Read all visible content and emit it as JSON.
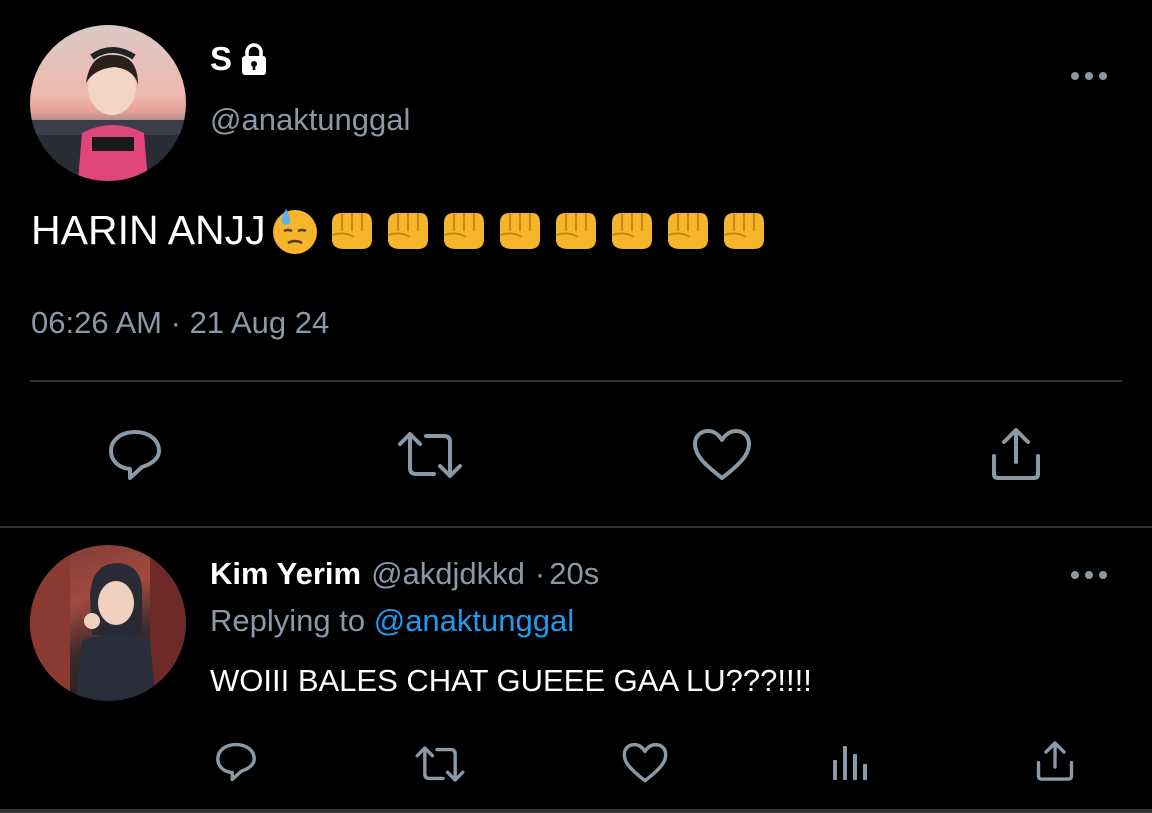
{
  "main_tweet": {
    "display_name": "S",
    "handle": "@anaktunggal",
    "text": "HARIN ANJJ",
    "emojis": [
      "downcast-face-with-sweat",
      "oncoming-fist",
      "oncoming-fist",
      "oncoming-fist",
      "oncoming-fist",
      "oncoming-fist",
      "oncoming-fist",
      "oncoming-fist",
      "oncoming-fist"
    ],
    "time": "06:26 AM",
    "separator": "·",
    "date": "21 Aug 24"
  },
  "reply": {
    "display_name": "Kim Yerim",
    "handle": "@akdjdkkd",
    "separator": "·",
    "age": "20s",
    "replying_prefix": "Replying to",
    "replying_to": "@anaktunggal",
    "text": "WOIII BALES CHAT GUEEE GAA LU???!!!!"
  },
  "icons": {
    "more": "more-horizontal-icon",
    "reply": "reply-icon",
    "retweet": "retweet-icon",
    "like": "heart-icon",
    "share": "share-icon",
    "analytics": "analytics-icon",
    "lock": "lock-icon"
  },
  "colors": {
    "background": "#000000",
    "text_primary": "#ffffff",
    "text_secondary": "#8b98a5",
    "accent": "#1d9bf0",
    "divider": "#2f3336"
  }
}
